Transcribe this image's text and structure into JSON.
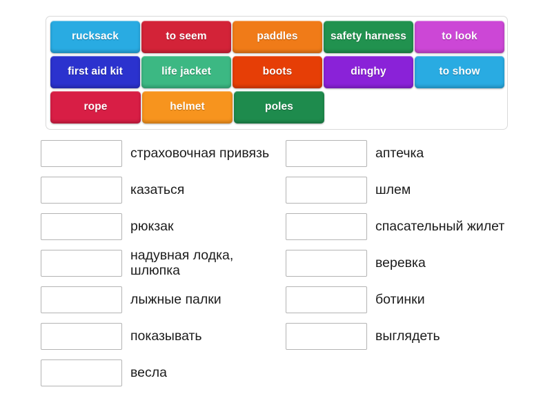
{
  "activity": {
    "type": "match-up",
    "tile_tray": {
      "rows": [
        [
          {
            "label": "rucksack",
            "color": "#29ABE2"
          },
          {
            "label": "to seem",
            "color": "#D32338"
          },
          {
            "label": "paddles",
            "color": "#F07B18"
          },
          {
            "label": "safety harness",
            "color": "#21924F"
          },
          {
            "label": "to look",
            "color": "#CC47D6"
          }
        ],
        [
          {
            "label": "first aid kit",
            "color": "#2B32CE"
          },
          {
            "label": "life jacket",
            "color": "#3CB883"
          },
          {
            "label": "boots",
            "color": "#E63E06"
          },
          {
            "label": "dinghy",
            "color": "#8A22D8"
          },
          {
            "label": "to show",
            "color": "#29ABE2"
          }
        ],
        [
          {
            "label": "rope",
            "color": "#D81E45"
          },
          {
            "label": "helmet",
            "color": "#F7941E"
          },
          {
            "label": "poles",
            "color": "#1E8B4D"
          }
        ]
      ]
    },
    "answers": {
      "left_column": [
        {
          "label": "страховочная привязь",
          "value": ""
        },
        {
          "label": "казаться",
          "value": ""
        },
        {
          "label": "рюкзак",
          "value": ""
        },
        {
          "label": "надувная лодка, шлюпка",
          "value": ""
        },
        {
          "label": "лыжные палки",
          "value": ""
        },
        {
          "label": "показывать",
          "value": ""
        },
        {
          "label": "весла",
          "value": ""
        }
      ],
      "right_column": [
        {
          "label": "аптечка",
          "value": ""
        },
        {
          "label": "шлем",
          "value": ""
        },
        {
          "label": "спасательный жилет",
          "value": ""
        },
        {
          "label": "веревка",
          "value": ""
        },
        {
          "label": "ботинки",
          "value": ""
        },
        {
          "label": "выглядеть",
          "value": ""
        }
      ]
    },
    "colors": {
      "tray_border": "#d9d9d9",
      "drop_box_border": "#b3b3b3",
      "text": "#1c1c1c",
      "background": "#ffffff"
    }
  }
}
